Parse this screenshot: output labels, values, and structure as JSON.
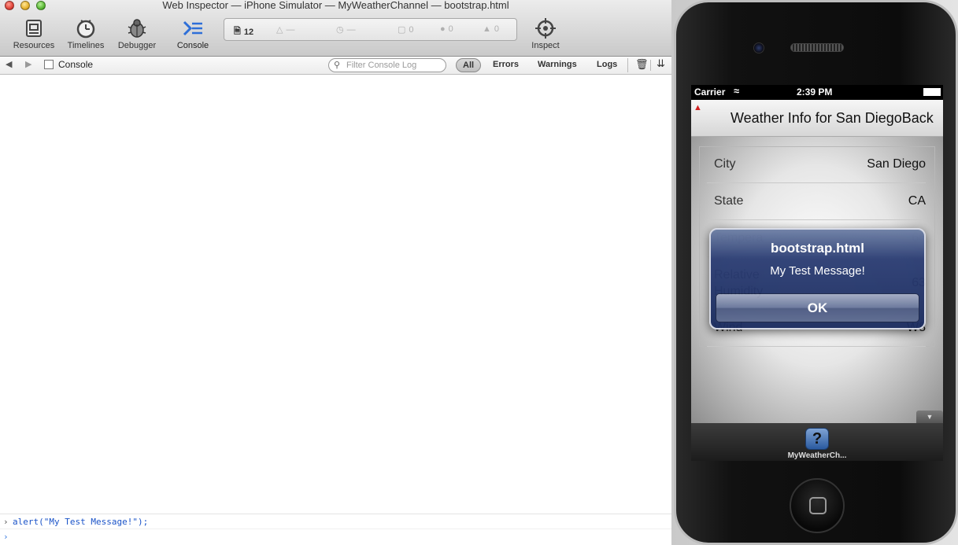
{
  "window": {
    "title": "Web Inspector — iPhone Simulator — MyWeatherChannel — bootstrap.html"
  },
  "toolbar": {
    "resources": "Resources",
    "timelines": "Timelines",
    "debugger": "Debugger",
    "console": "Console",
    "inspect": "Inspect"
  },
  "activity": {
    "resources_count": "12",
    "load_time": "—",
    "duration": "—",
    "logs": "0",
    "errors": "0",
    "warnings": "0"
  },
  "filterbar": {
    "tab_label": "Console",
    "search_placeholder": "Filter Console Log",
    "filters": [
      "All",
      "Errors",
      "Warnings",
      "Logs"
    ]
  },
  "console": {
    "entries": [
      "alert(\"My Test Message!\");"
    ],
    "input_value": ""
  },
  "simulator": {
    "status": {
      "carrier": "Carrier",
      "time": "2:39 PM"
    },
    "navbar_title": "Weather Info for San DiegoBack",
    "rows": [
      {
        "key": "City",
        "value": "San Diego"
      },
      {
        "key": "State",
        "value": "CA"
      },
      {
        "key": "Tempera",
        "value": "66"
      },
      {
        "key": "Relative Humidity",
        "value": "63"
      },
      {
        "key": "Wind",
        "value": "W8"
      }
    ],
    "alert": {
      "title": "bootstrap.html",
      "message": "My Test Message!",
      "button": "OK"
    },
    "app_label": "MyWeatherCh...",
    "app_icon_glyph": "?"
  }
}
